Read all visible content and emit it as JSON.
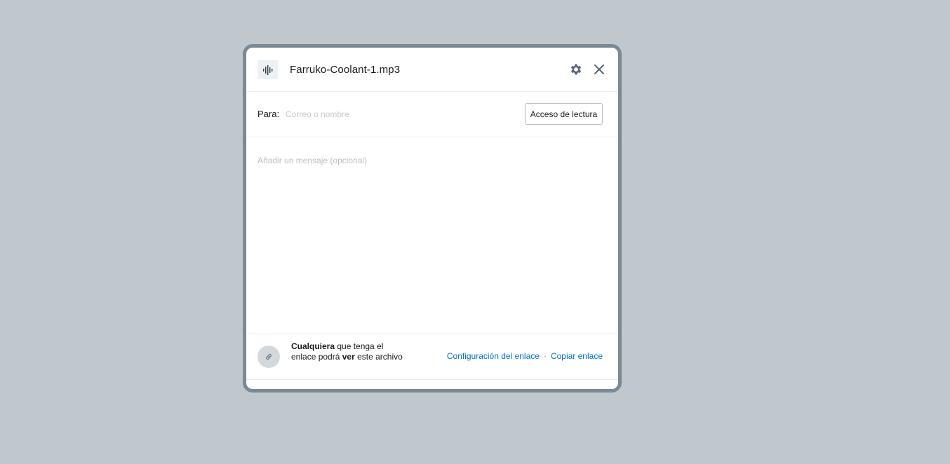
{
  "dialog": {
    "file_name": "Farruko-Coolant-1.mp3",
    "file_icon": "audio-waveform-icon",
    "settings_icon": "gear-icon",
    "close_icon": "close-icon"
  },
  "recipients": {
    "label": "Para:",
    "placeholder": "Correo o nombre",
    "value": "",
    "access_button": "Acceso de lectura"
  },
  "message": {
    "placeholder": "Añadir un mensaje (opcional)",
    "value": ""
  },
  "link_share": {
    "icon": "link-icon",
    "text_strong_1": "Cualquiera",
    "text_1": " que tenga el enlace podrá ",
    "text_strong_2": "ver",
    "text_2": " este archivo",
    "settings_link": "Configuración del enlace",
    "separator": "·",
    "copy_link": "Copiar enlace"
  },
  "colors": {
    "background": "#c0c7cd",
    "frame_border": "#7b8994",
    "link_color": "#0070c9"
  }
}
